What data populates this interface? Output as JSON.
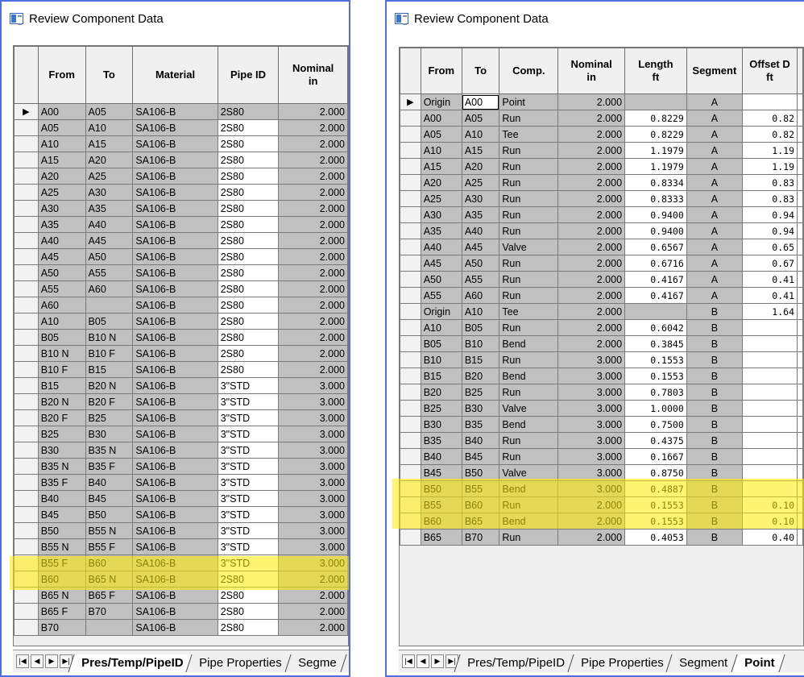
{
  "left": {
    "title": "Review Component Data",
    "columns": [
      "From",
      "To",
      "Material",
      "Pipe ID",
      "Nominal\nin"
    ],
    "rows": [
      [
        "A00",
        "A05",
        "SA106-B",
        "2S80",
        "2.000"
      ],
      [
        "A05",
        "A10",
        "SA106-B",
        "2S80",
        "2.000"
      ],
      [
        "A10",
        "A15",
        "SA106-B",
        "2S80",
        "2.000"
      ],
      [
        "A15",
        "A20",
        "SA106-B",
        "2S80",
        "2.000"
      ],
      [
        "A20",
        "A25",
        "SA106-B",
        "2S80",
        "2.000"
      ],
      [
        "A25",
        "A30",
        "SA106-B",
        "2S80",
        "2.000"
      ],
      [
        "A30",
        "A35",
        "SA106-B",
        "2S80",
        "2.000"
      ],
      [
        "A35",
        "A40",
        "SA106-B",
        "2S80",
        "2.000"
      ],
      [
        "A40",
        "A45",
        "SA106-B",
        "2S80",
        "2.000"
      ],
      [
        "A45",
        "A50",
        "SA106-B",
        "2S80",
        "2.000"
      ],
      [
        "A50",
        "A55",
        "SA106-B",
        "2S80",
        "2.000"
      ],
      [
        "A55",
        "A60",
        "SA106-B",
        "2S80",
        "2.000"
      ],
      [
        "A60",
        "",
        "SA106-B",
        "2S80",
        "2.000"
      ],
      [
        "A10",
        "B05",
        "SA106-B",
        "2S80",
        "2.000"
      ],
      [
        "B05",
        "B10 N",
        "SA106-B",
        "2S80",
        "2.000"
      ],
      [
        "B10 N",
        "B10 F",
        "SA106-B",
        "2S80",
        "2.000"
      ],
      [
        "B10 F",
        "B15",
        "SA106-B",
        "2S80",
        "2.000"
      ],
      [
        "B15",
        "B20 N",
        "SA106-B",
        "3\"STD",
        "3.000"
      ],
      [
        "B20 N",
        "B20 F",
        "SA106-B",
        "3\"STD",
        "3.000"
      ],
      [
        "B20 F",
        "B25",
        "SA106-B",
        "3\"STD",
        "3.000"
      ],
      [
        "B25",
        "B30",
        "SA106-B",
        "3\"STD",
        "3.000"
      ],
      [
        "B30",
        "B35 N",
        "SA106-B",
        "3\"STD",
        "3.000"
      ],
      [
        "B35 N",
        "B35 F",
        "SA106-B",
        "3\"STD",
        "3.000"
      ],
      [
        "B35 F",
        "B40",
        "SA106-B",
        "3\"STD",
        "3.000"
      ],
      [
        "B40",
        "B45",
        "SA106-B",
        "3\"STD",
        "3.000"
      ],
      [
        "B45",
        "B50",
        "SA106-B",
        "3\"STD",
        "3.000"
      ],
      [
        "B50",
        "B55 N",
        "SA106-B",
        "3\"STD",
        "3.000"
      ],
      [
        "B55 N",
        "B55 F",
        "SA106-B",
        "3\"STD",
        "3.000"
      ],
      [
        "B55 F",
        "B60",
        "SA106-B",
        "3\"STD",
        "3.000"
      ],
      [
        "B60",
        "B65 N",
        "SA106-B",
        "2S80",
        "2.000"
      ],
      [
        "B65 N",
        "B65 F",
        "SA106-B",
        "2S80",
        "2.000"
      ],
      [
        "B65 F",
        "B70",
        "SA106-B",
        "2S80",
        "2.000"
      ],
      [
        "B70",
        "",
        "SA106-B",
        "2S80",
        "2.000"
      ]
    ],
    "tabs": [
      "Pres/Temp/PipeID",
      "Pipe Properties",
      "Segme"
    ],
    "active_tab": 0
  },
  "right": {
    "title": "Review Component Data",
    "columns": [
      "From",
      "To",
      "Comp.",
      "Nominal\nin",
      "Length\nft",
      "Segment",
      "Offset D\nft"
    ],
    "rows": [
      [
        "Origin",
        "A00",
        "Point",
        "2.000",
        "",
        "A",
        ""
      ],
      [
        "A00",
        "A05",
        "Run",
        "2.000",
        "0.8229",
        "A",
        "0.82"
      ],
      [
        "A05",
        "A10",
        "Tee",
        "2.000",
        "0.8229",
        "A",
        "0.82"
      ],
      [
        "A10",
        "A15",
        "Run",
        "2.000",
        "1.1979",
        "A",
        "1.19"
      ],
      [
        "A15",
        "A20",
        "Run",
        "2.000",
        "1.1979",
        "A",
        "1.19"
      ],
      [
        "A20",
        "A25",
        "Run",
        "2.000",
        "0.8334",
        "A",
        "0.83"
      ],
      [
        "A25",
        "A30",
        "Run",
        "2.000",
        "0.8333",
        "A",
        "0.83"
      ],
      [
        "A30",
        "A35",
        "Run",
        "2.000",
        "0.9400",
        "A",
        "0.94"
      ],
      [
        "A35",
        "A40",
        "Run",
        "2.000",
        "0.9400",
        "A",
        "0.94"
      ],
      [
        "A40",
        "A45",
        "Valve",
        "2.000",
        "0.6567",
        "A",
        "0.65"
      ],
      [
        "A45",
        "A50",
        "Run",
        "2.000",
        "0.6716",
        "A",
        "0.67"
      ],
      [
        "A50",
        "A55",
        "Run",
        "2.000",
        "0.4167",
        "A",
        "0.41"
      ],
      [
        "A55",
        "A60",
        "Run",
        "2.000",
        "0.4167",
        "A",
        "0.41"
      ],
      [
        "Origin",
        "A10",
        "Tee",
        "2.000",
        "",
        "B",
        "1.64"
      ],
      [
        "A10",
        "B05",
        "Run",
        "2.000",
        "0.6042",
        "B",
        ""
      ],
      [
        "B05",
        "B10",
        "Bend",
        "2.000",
        "0.3845",
        "B",
        ""
      ],
      [
        "B10",
        "B15",
        "Run",
        "3.000",
        "0.1553",
        "B",
        ""
      ],
      [
        "B15",
        "B20",
        "Bend",
        "3.000",
        "0.1553",
        "B",
        ""
      ],
      [
        "B20",
        "B25",
        "Run",
        "3.000",
        "0.7803",
        "B",
        ""
      ],
      [
        "B25",
        "B30",
        "Valve",
        "3.000",
        "1.0000",
        "B",
        ""
      ],
      [
        "B30",
        "B35",
        "Bend",
        "3.000",
        "0.7500",
        "B",
        ""
      ],
      [
        "B35",
        "B40",
        "Run",
        "3.000",
        "0.4375",
        "B",
        ""
      ],
      [
        "B40",
        "B45",
        "Run",
        "3.000",
        "0.1667",
        "B",
        ""
      ],
      [
        "B45",
        "B50",
        "Valve",
        "3.000",
        "0.8750",
        "B",
        ""
      ],
      [
        "B50",
        "B55",
        "Bend",
        "3.000",
        "0.4887",
        "B",
        ""
      ],
      [
        "B55",
        "B60",
        "Run",
        "2.000",
        "0.1553",
        "B",
        "0.10"
      ],
      [
        "B60",
        "B65",
        "Bend",
        "2.000",
        "0.1553",
        "B",
        "0.10"
      ],
      [
        "B65",
        "B70",
        "Run",
        "2.000",
        "0.4053",
        "B",
        "0.40"
      ]
    ],
    "tabs": [
      "Pres/Temp/PipeID",
      "Pipe Properties",
      "Segment",
      "Point"
    ],
    "active_tab": 3
  },
  "colors": {
    "highlight": "#ffec00",
    "cell_gray": "#c0c0c0",
    "cell_white": "#ffffff",
    "window_border": "#4f6ee0"
  },
  "icons": {
    "current_row": "triangle-right-icon",
    "nav": [
      "first-icon",
      "prev-icon",
      "next-icon",
      "last-icon"
    ]
  }
}
